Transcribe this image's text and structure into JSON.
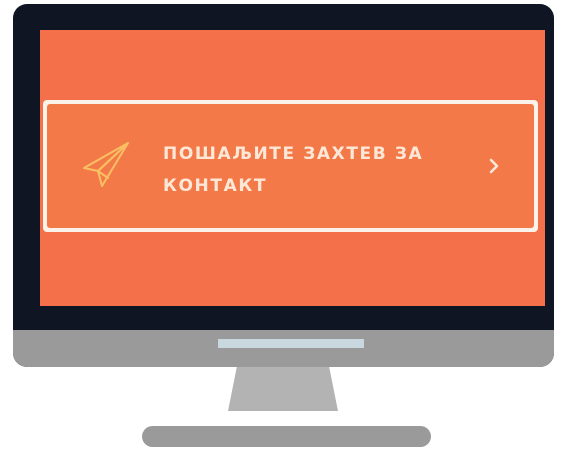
{
  "cta": {
    "line1": "ПОШАЉИТЕ ЗАХТЕВ ЗА",
    "line2": "КОНТАКТ",
    "icon": "paper-plane-icon",
    "arrow_icon": "chevron-right-icon"
  },
  "colors": {
    "screen_background": "#f4704b",
    "button_background": "#f37a48",
    "button_border": "#fbf2ea",
    "text": "#fde8d8",
    "icon_stroke": "#f9c063",
    "bezel": "#0f1522",
    "stand": "#9a9a9a"
  }
}
